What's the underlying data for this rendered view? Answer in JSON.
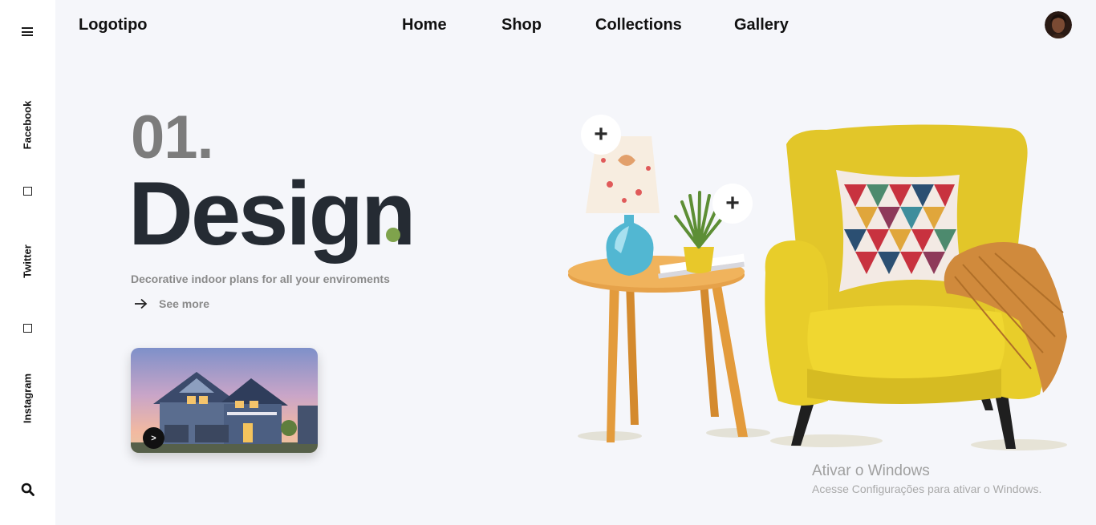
{
  "header": {
    "logo": "Logotipo",
    "nav": [
      "Home",
      "Shop",
      "Collections",
      "Gallery"
    ]
  },
  "sidebar": {
    "social": [
      "Facebook",
      "Twitter",
      "Instagram"
    ]
  },
  "hero": {
    "number": "01.",
    "title": "Design",
    "subtitle": "Decorative indoor plans for all your enviroments",
    "see_more": "See more",
    "play_label": ">"
  },
  "icons": {
    "menu": "hamburger-icon",
    "search": "search-icon",
    "arrow": "arrow-right-icon",
    "plus": "plus-icon"
  },
  "colors": {
    "accent_dot": "#7fa34c",
    "title": "#252b33",
    "chair": "#e8cd2a"
  },
  "watermark": {
    "title": "Ativar o Windows",
    "subtitle": "Acesse Configurações para ativar o Windows."
  }
}
